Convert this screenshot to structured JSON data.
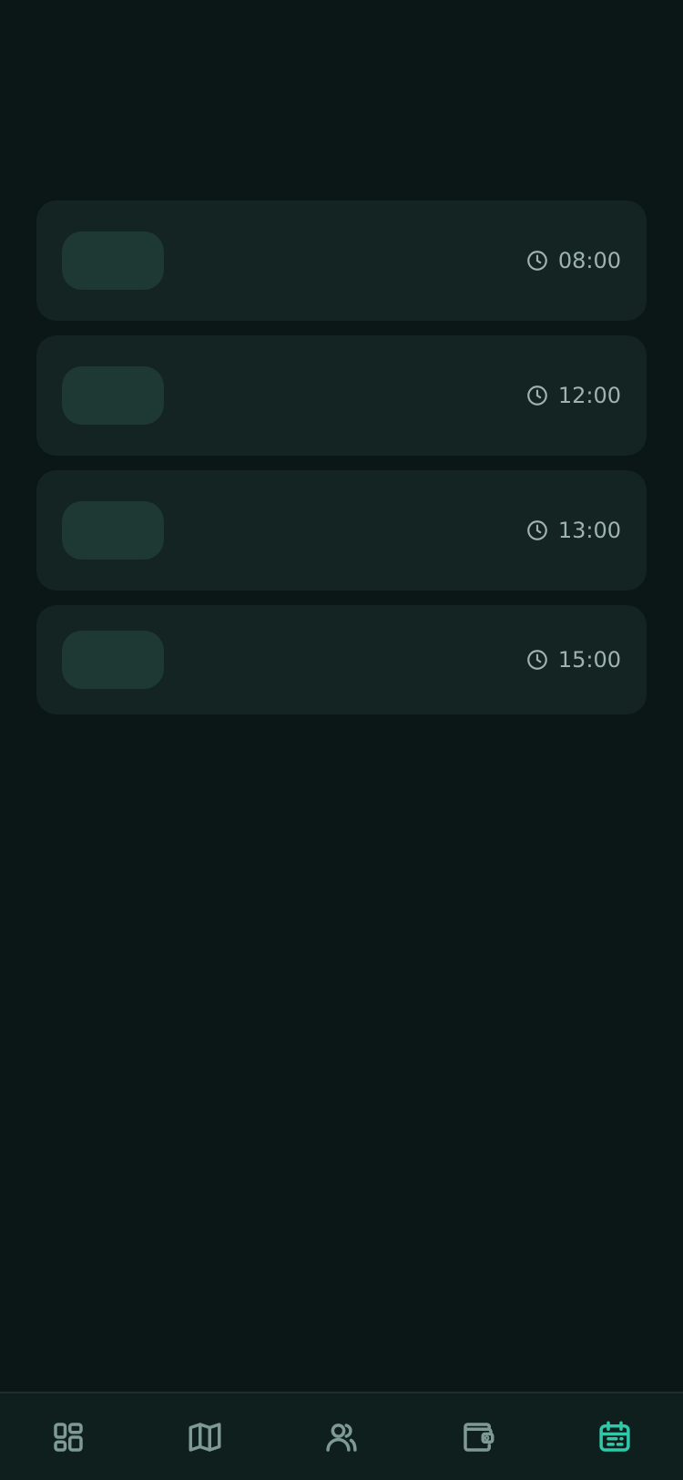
{
  "schedule": {
    "items": [
      {
        "time": "08:00"
      },
      {
        "time": "12:00"
      },
      {
        "time": "13:00"
      },
      {
        "time": "15:00"
      }
    ]
  },
  "navigation": {
    "items": [
      {
        "icon": "dashboard-icon",
        "active": false
      },
      {
        "icon": "map-icon",
        "active": false
      },
      {
        "icon": "users-icon",
        "active": false
      },
      {
        "icon": "wallet-icon",
        "active": false
      },
      {
        "icon": "calendar-icon",
        "active": true
      }
    ]
  },
  "colors": {
    "background": "#0a1716",
    "card": "#132422",
    "placeholder": "#1e3834",
    "text_muted": "#9eb3ae",
    "accent": "#2ec9a9"
  }
}
